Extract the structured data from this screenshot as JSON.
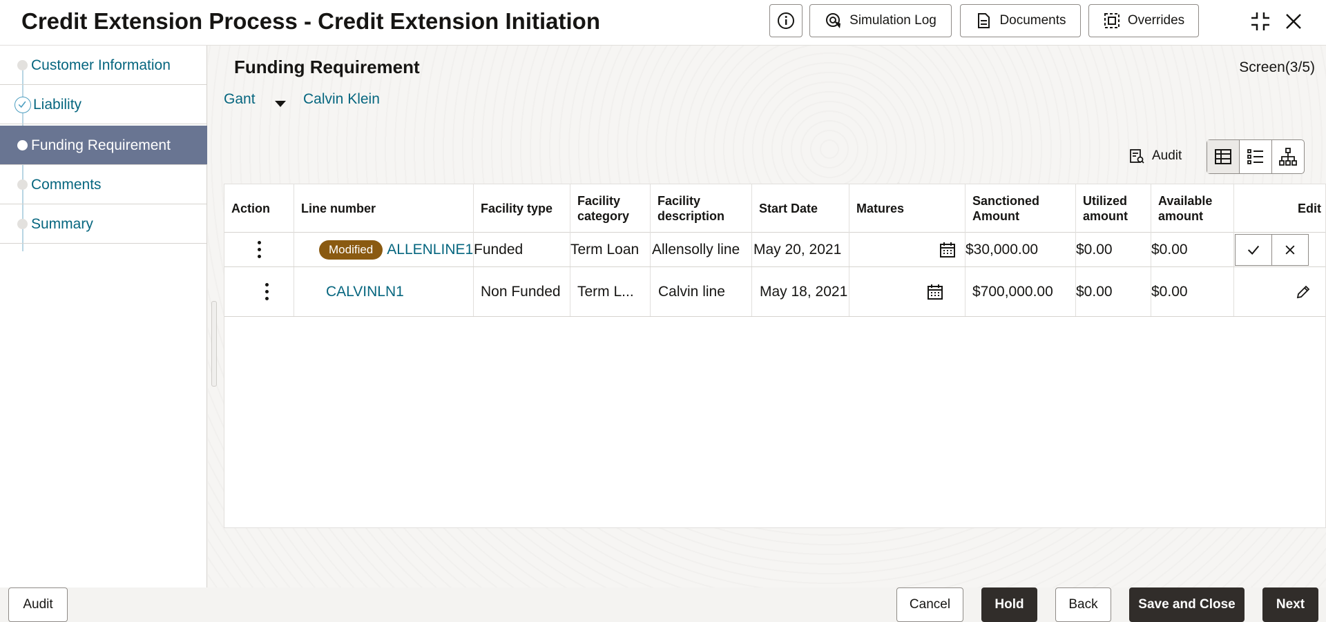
{
  "header": {
    "title": "Credit Extension Process - Credit Extension Initiation",
    "buttons": {
      "info_icon": "info-icon",
      "simulation_log": "Simulation Log",
      "documents": "Documents",
      "overrides": "Overrides"
    }
  },
  "nav": {
    "items": [
      {
        "label": "Customer Information",
        "state": "pending"
      },
      {
        "label": "Liability",
        "state": "completed"
      },
      {
        "label": "Funding Requirement",
        "state": "active"
      },
      {
        "label": "Comments",
        "state": "pending"
      },
      {
        "label": "Summary",
        "state": "pending"
      }
    ]
  },
  "main": {
    "section_title": "Funding Requirement",
    "screen_count": "Screen(3/5)",
    "customer": {
      "name": "Gant",
      "counterpart": "Calvin Klein"
    },
    "audit_label": "Audit"
  },
  "table": {
    "columns": [
      "Action",
      "Line number",
      "Facility type",
      "Facility category",
      "Facility description",
      "Start Date",
      "Matures",
      "Sanctioned Amount",
      "Utilized amount",
      "Available amount",
      "Edit"
    ],
    "rows": [
      {
        "badge": "Modified",
        "line_number": "ALLENLINE1",
        "facility_type": "Funded",
        "facility_category": "Term Loan",
        "facility_description": "Allensolly line",
        "start_date": "May 20, 2021",
        "matures": "",
        "sanctioned_amount": "$30,000.00",
        "utilized_amount": "$0.00",
        "available_amount": "$0.00",
        "editing": true
      },
      {
        "badge": "",
        "line_number": "CALVINLN1",
        "facility_type": "Non Funded",
        "facility_category": "Term L...",
        "facility_description": "Calvin line",
        "start_date": "May 18, 2021",
        "matures": "",
        "sanctioned_amount": "$700,000.00",
        "utilized_amount": "$0.00",
        "available_amount": "$0.00",
        "editing": false
      }
    ]
  },
  "footer": {
    "audit": "Audit",
    "cancel": "Cancel",
    "hold": "Hold",
    "back": "Back",
    "save_and_close": "Save and Close",
    "next": "Next"
  },
  "colors": {
    "link": "#06667f",
    "active_nav": "#697592",
    "badge": "#8a5a11",
    "solid_button": "#312d2a"
  }
}
